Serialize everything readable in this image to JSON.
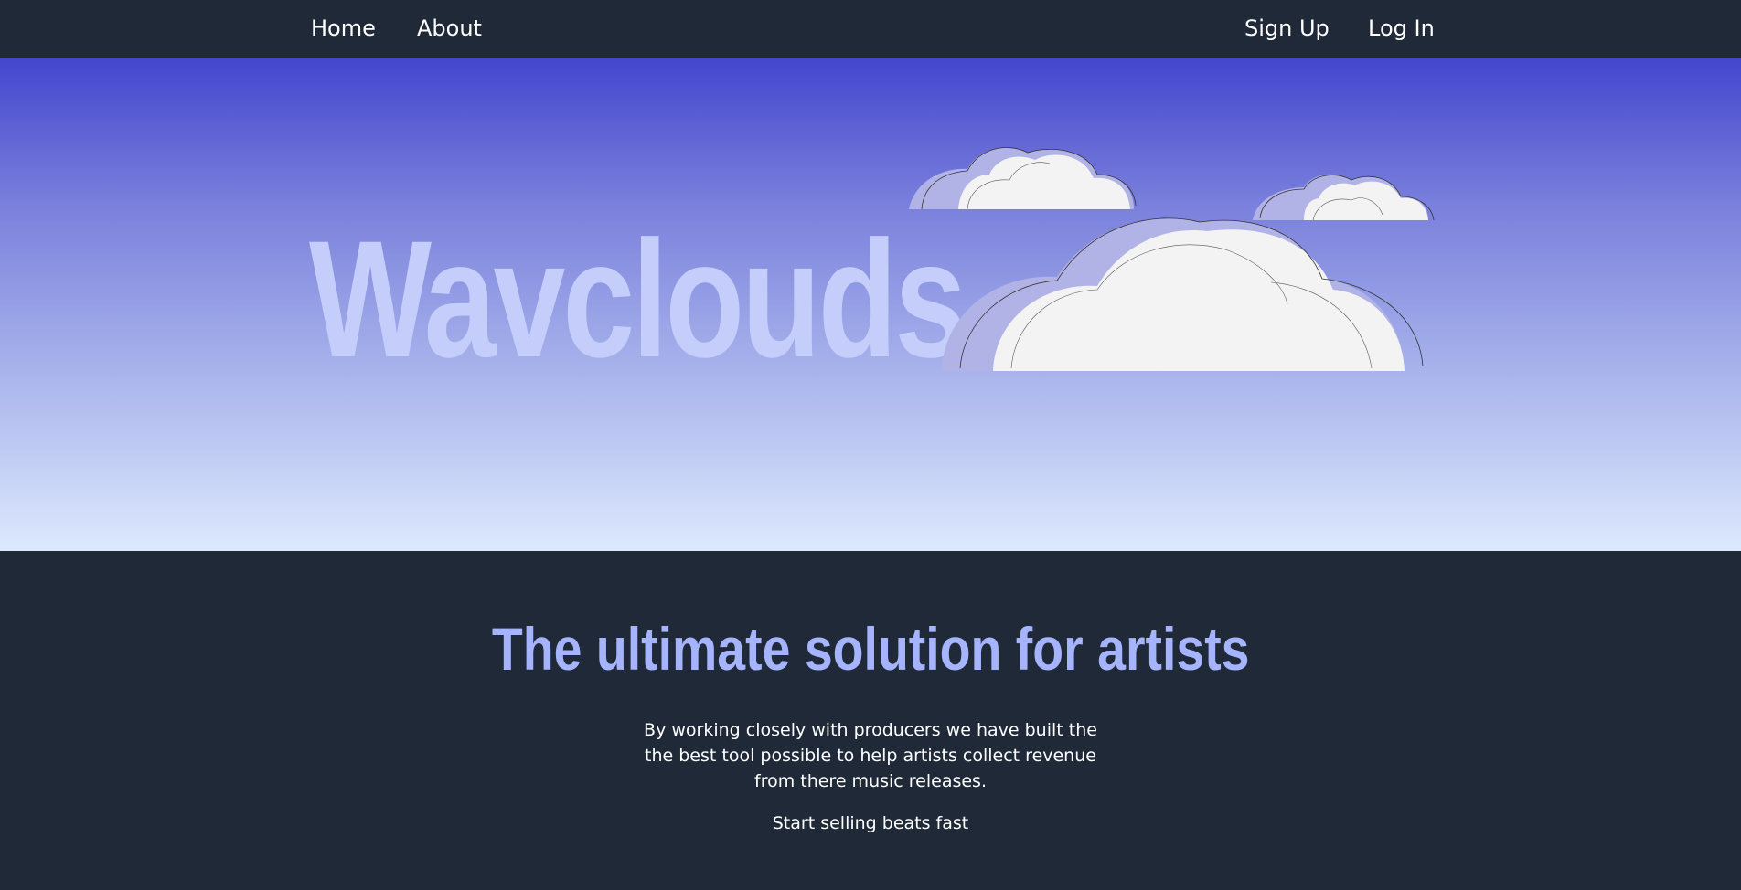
{
  "nav": {
    "home_label": "Home",
    "about_label": "About",
    "signup_label": "Sign Up",
    "login_label": "Log In"
  },
  "hero": {
    "title": "Wavclouds",
    "clouds": [
      "cloud-icon",
      "cloud-icon",
      "cloud-icon"
    ]
  },
  "content": {
    "tagline": "The ultimate solution for artists",
    "description": "By working closely with producers we have built the the best tool possible to help artists collect revenue from there music releases.",
    "cta": "Start selling beats fast"
  },
  "colors": {
    "nav_bg": "#1f2937",
    "hero_top": "#4346ce",
    "hero_bottom": "#dde9fd",
    "hero_title": "#c5cefb",
    "tagline": "#a5b4fc",
    "cloud_fill": "#f3f3f3",
    "cloud_shadow": "#b1b2e6"
  }
}
